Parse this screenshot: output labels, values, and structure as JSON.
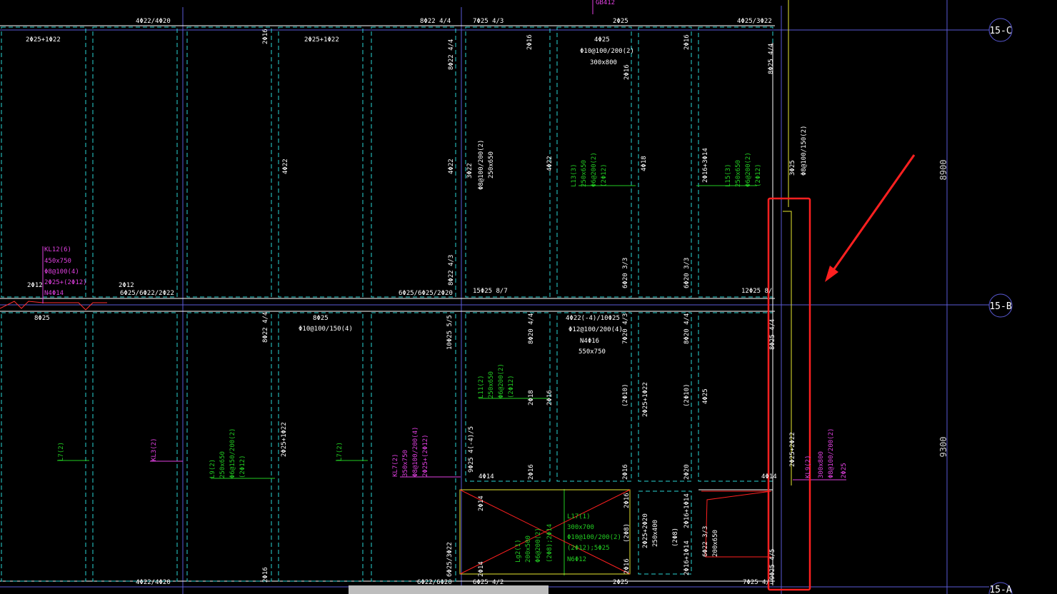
{
  "axes": {
    "top": "15-C",
    "mid": "15-B",
    "bottom": "15-A"
  },
  "dimensions": {
    "upper": "8900",
    "lower": "9300"
  },
  "colors": {
    "background": "#000000",
    "axis": "#5a5ad6",
    "frame_dash": "#2ad4d4",
    "beam_white": "#ffffff",
    "beam_green": "#22cc22",
    "beam_magenta": "#e040e0",
    "highlight": "#ff2020",
    "yellow": "#e8e830"
  },
  "top_rebar": {
    "a": "4Φ22/4Φ20",
    "b": "8Φ22 4/4",
    "c": "7Φ25 4/3",
    "d": "2Φ25",
    "e": "4Φ25/3Φ22",
    "tag": "GB412"
  },
  "upper_labels": {
    "p1": "2Φ25+1Φ22",
    "p2": "2Φ16",
    "p3": "2Φ25+1Φ22",
    "p4": "2Φ16",
    "p5": "8Φ22 4/4",
    "b1_a": "4Φ25",
    "b1_b": "Φ10@100/200(2)",
    "b1_c": "300x800",
    "p6": "2Φ16",
    "p7": "8Φ25 4/4",
    "v1": "4Φ22",
    "v2": "3Φ22",
    "v3": "Φ8@100/200(2)",
    "v4": "250x650",
    "v5": "4Φ22",
    "v6": "2Φ16",
    "v7": "4Φ18",
    "v8": "2Φ16+3Φ14",
    "v9": "3Φ25",
    "v10": "Φ8@100/150(2)",
    "v11": "8Φ22 4/3",
    "v12": "6Φ20 3/3",
    "v13": "6Φ20 3/3"
  },
  "green_upper": {
    "l13_a": "L13(3)",
    "l13_b": "250x650",
    "l13_c": "Φ6@200(2)",
    "l13_d": "(2Φ12)",
    "l15_a": "L15(3)",
    "l15_b": "250x650",
    "l15_c": "Φ6@200(2)",
    "l15_d": "(2Φ12)"
  },
  "kl12": {
    "name": "KL12(6)",
    "size": "450x750",
    "stirrup": "Φ8@100(4)",
    "top": "2Φ25+(2Φ12)",
    "side": "N4Φ14"
  },
  "mid_rebar": {
    "a": "2Φ12",
    "b": "2Φ12",
    "c": "6Φ25/6Φ22/2Φ22",
    "d": "6Φ25/6Φ25/2Φ20",
    "e": "15Φ25 8/7",
    "f": "12Φ25 8/",
    "g": "8Φ25",
    "h": "8Φ25",
    "i": "Φ10@100/150(4)"
  },
  "lower_labels": {
    "a": "8Φ22 4/4",
    "b": "10Φ25 5/5",
    "c": "8Φ20 4/4",
    "d": "4Φ22(-4)/10Φ25",
    "e": "Φ12@100/200(4)",
    "f": "N4Φ16",
    "g": "550x750",
    "h": "7Φ20 4/3",
    "i": "8Φ20 4/4",
    "j": "8Φ25 4/4",
    "k": "2Φ18",
    "l": "2Φ16",
    "m": "(2Φ10)",
    "n": "2Φ25+1Φ22",
    "o": "(2Φ10)",
    "p": "4Φ25",
    "q": "2Φ25+1Φ22",
    "r": "2Φ25+2Φ22",
    "s": "9Φ25 4(-4)/5",
    "t": "4Φ14",
    "u": "2Φ16",
    "v": "2Φ16",
    "w": "2Φ20",
    "x": "4Φ14",
    "y": "2Φ25+1Φ22"
  },
  "green_lower": {
    "l11_a": "L11(2)",
    "l11_b": "250x650",
    "l11_c": "Φ6@200(2)",
    "l11_d": "(2Φ12)",
    "l7a": "L7(2)",
    "l9_a": "L9(2)",
    "l9_b": "250x650",
    "l9_c": "Φ6@150/200(2)",
    "l9_d": "(2Φ12)",
    "l7b": "L7(2)"
  },
  "magenta_lower": {
    "kl3": "KL3(2)",
    "kl7_a": "KL7(2)",
    "kl7_b": "350x750",
    "kl7_c": "Φ8@100/200(4)",
    "kl7_d": "2Φ25+(2Φ12)",
    "r_a": "KL9(2)",
    "r_b": "300x800",
    "r_c": "Φ8@100/200(2)",
    "r_d": "2Φ25"
  },
  "bottom_block": {
    "l17_a": "L17(1)",
    "l17_b": "300x700",
    "l17_c": "Φ10@100/200(2)",
    "l17_d": "(2Φ12);5Φ25",
    "l17_e": "N6Φ12",
    "lg_a": "Lg2(1)",
    "lg_b": "200x500",
    "lg_c": "Φ6@200(2)",
    "lg_d": "(2Φ8);2Φ14",
    "w1": "2Φ14",
    "w2": "2Φ14",
    "w3": "2Φ16",
    "w4": "(2Φ8)",
    "w5": "2Φ16",
    "w6": "2Φ25+2Φ20",
    "w7": "250x400",
    "w8": "(2Φ8)",
    "w9": "2Φ16+1Φ14",
    "w10": "2Φ16+1Φ14",
    "w11": "6Φ22 3/3",
    "w12": "200x650",
    "w13": "6Φ25/3Φ22",
    "w14": "9Φ25 4/5",
    "w15": "2Φ16"
  },
  "bottom_rebar": {
    "a": "4Φ22/4Φ20",
    "b": "6Φ22/6Φ20",
    "c": "6Φ25 4/2",
    "d": "2Φ25",
    "e": "2Φ16",
    "f": "7Φ25 4/3"
  }
}
